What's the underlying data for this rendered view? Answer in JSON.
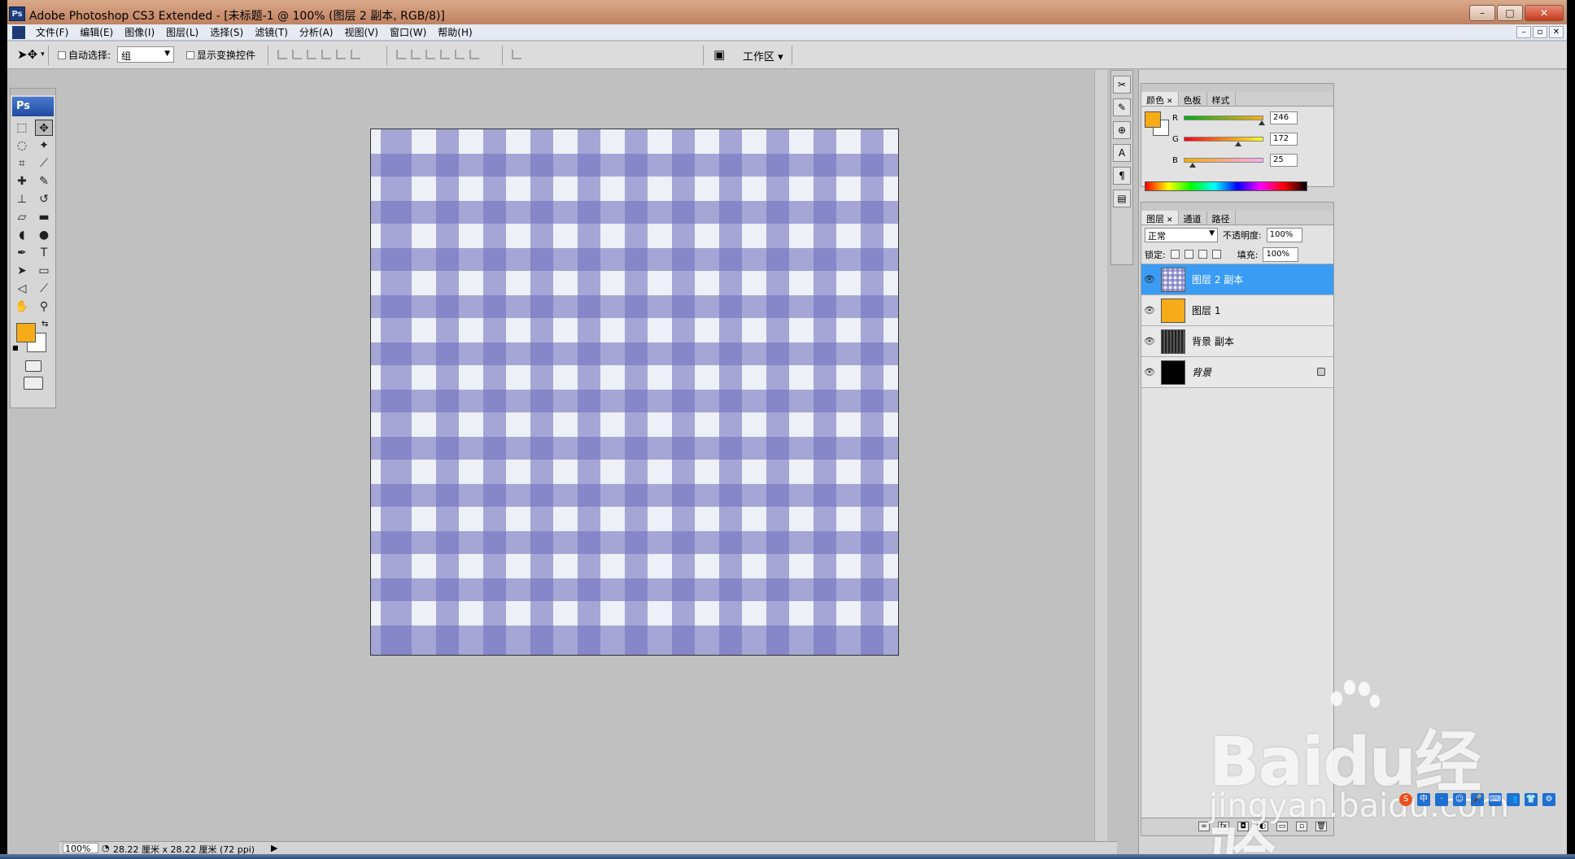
{
  "window": {
    "title": "Adobe Photoshop CS3 Extended - [未标题-1 @ 100% (图层 2 副本, RGB/8)]",
    "ps_logo": "Ps",
    "min": "–",
    "max": "□",
    "close": "✕"
  },
  "menu": {
    "items": [
      "文件(F)",
      "编辑(E)",
      "图像(I)",
      "图层(L)",
      "选择(S)",
      "滤镜(T)",
      "分析(A)",
      "视图(V)",
      "窗口(W)",
      "帮助(H)"
    ],
    "doc_min": "–",
    "doc_restore": "▫",
    "doc_close": "✕"
  },
  "options": {
    "auto_select_label": "自动选择:",
    "auto_select_value": "组",
    "show_transform_label": "显示变换控件",
    "workspace_label": "工作区 ▾"
  },
  "toolbox": {
    "logo": "Ps",
    "tools": [
      {
        "name": "marquee-tool-icon",
        "glyph": "⬚"
      },
      {
        "name": "move-tool-icon",
        "glyph": "✥"
      },
      {
        "name": "lasso-tool-icon",
        "glyph": "◌"
      },
      {
        "name": "magic-wand-tool-icon",
        "glyph": "✦"
      },
      {
        "name": "crop-tool-icon",
        "glyph": "⌗"
      },
      {
        "name": "slice-tool-icon",
        "glyph": "⟋"
      },
      {
        "name": "healing-brush-tool-icon",
        "glyph": "✚"
      },
      {
        "name": "brush-tool-icon",
        "glyph": "✎"
      },
      {
        "name": "clone-stamp-tool-icon",
        "glyph": "⊥"
      },
      {
        "name": "history-brush-tool-icon",
        "glyph": "↺"
      },
      {
        "name": "eraser-tool-icon",
        "glyph": "▱"
      },
      {
        "name": "gradient-tool-icon",
        "glyph": "▬"
      },
      {
        "name": "blur-tool-icon",
        "glyph": "◖"
      },
      {
        "name": "dodge-tool-icon",
        "glyph": "●"
      },
      {
        "name": "pen-tool-icon",
        "glyph": "✒"
      },
      {
        "name": "type-tool-icon",
        "glyph": "T"
      },
      {
        "name": "path-selection-tool-icon",
        "glyph": "➤"
      },
      {
        "name": "shape-tool-icon",
        "glyph": "▭"
      },
      {
        "name": "notes-tool-icon",
        "glyph": "◁"
      },
      {
        "name": "eyedropper-tool-icon",
        "glyph": "⟋"
      },
      {
        "name": "hand-tool-icon",
        "glyph": "✋"
      },
      {
        "name": "zoom-tool-icon",
        "glyph": "⚲"
      }
    ],
    "foreground_color": "#f6ac19",
    "background_color": "#ffffff"
  },
  "document": {
    "pattern_color": "#7070be",
    "base_color": "#eef0f8"
  },
  "status": {
    "zoom": "100%",
    "info": "28.22 厘米 x 28.22 厘米 (72 ppi)"
  },
  "color_panel": {
    "tabs": [
      "颜色",
      "色板",
      "样式"
    ],
    "r_label": "R",
    "g_label": "G",
    "b_label": "B",
    "r": "246",
    "g": "172",
    "b": "25",
    "r_value": 246,
    "g_value": 172,
    "b_value": 25
  },
  "layers_panel": {
    "tabs": [
      "图层",
      "通道",
      "路径"
    ],
    "blend_mode": "正常",
    "opacity_label": "不透明度:",
    "opacity": "100%",
    "lock_label": "锁定:",
    "fill_label": "填充:",
    "fill": "100%",
    "layers": [
      {
        "name": "图层 2 副本",
        "selected": true,
        "thumb": "check"
      },
      {
        "name": "图层 1",
        "selected": false,
        "thumb": "orange"
      },
      {
        "name": "背景 副本",
        "selected": false,
        "thumb": "stripes"
      },
      {
        "name": "背景",
        "selected": false,
        "thumb": "black",
        "italic": true,
        "locked": true
      }
    ],
    "footer_icons": [
      "link-layers-icon",
      "fx-icon",
      "add-mask-icon",
      "adjustment-layer-icon",
      "new-group-icon",
      "new-layer-icon",
      "delete-layer-icon"
    ]
  },
  "watermark": {
    "brand": "Baidu经验",
    "url": "jingyan.baidu.com"
  },
  "ime": {
    "items": [
      "S",
      "中",
      "·",
      "☺",
      "🎤",
      "⌨",
      "👥",
      "👕",
      "⚙"
    ]
  }
}
